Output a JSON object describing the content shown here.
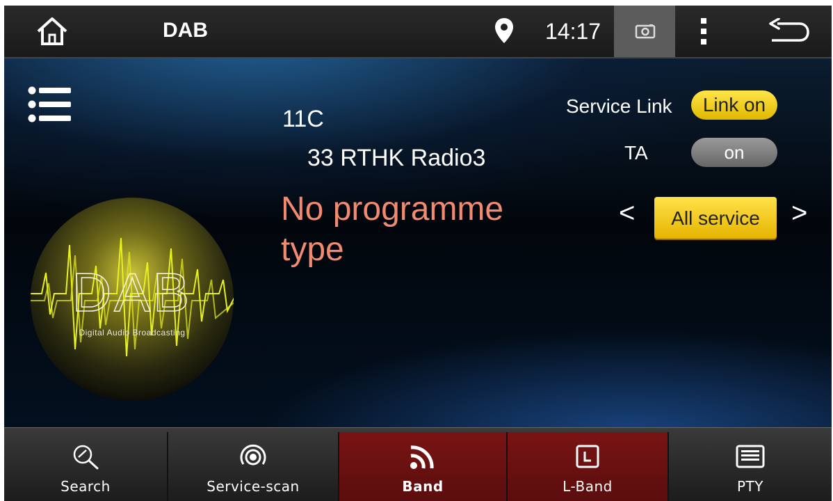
{
  "statusbar": {
    "title": "DAB",
    "time": "14:17",
    "icons": [
      "home-icon",
      "location-pin-icon",
      "screenshot-icon",
      "overflow-menu-icon",
      "back-icon"
    ]
  },
  "main": {
    "channel": "11C",
    "station": "33 RTHK Radio3",
    "programme_type": "No programme type",
    "service_link_label": "Service Link",
    "service_link_value": "Link on",
    "ta_label": "TA",
    "ta_value": "on",
    "prev_arrow": "<",
    "next_arrow": ">",
    "service_filter": "All service",
    "logo_text": "DAB",
    "logo_subtext": "Digital Audio Broadcasting",
    "colors": {
      "accent_yellow": "#f2c81a",
      "programme_text": "#f28a6f",
      "active_tab": "#6e1212"
    }
  },
  "toolbar": {
    "items": [
      {
        "label": "Search",
        "icon": "search-icon",
        "active": false
      },
      {
        "label": "Service-scan",
        "icon": "service-scan-icon",
        "active": false
      },
      {
        "label": "Band",
        "icon": "band-icon",
        "active": true
      },
      {
        "label": "L-Band",
        "icon": "l-band-icon",
        "active": true
      },
      {
        "label": "PTY",
        "icon": "pty-icon",
        "active": false
      }
    ]
  }
}
